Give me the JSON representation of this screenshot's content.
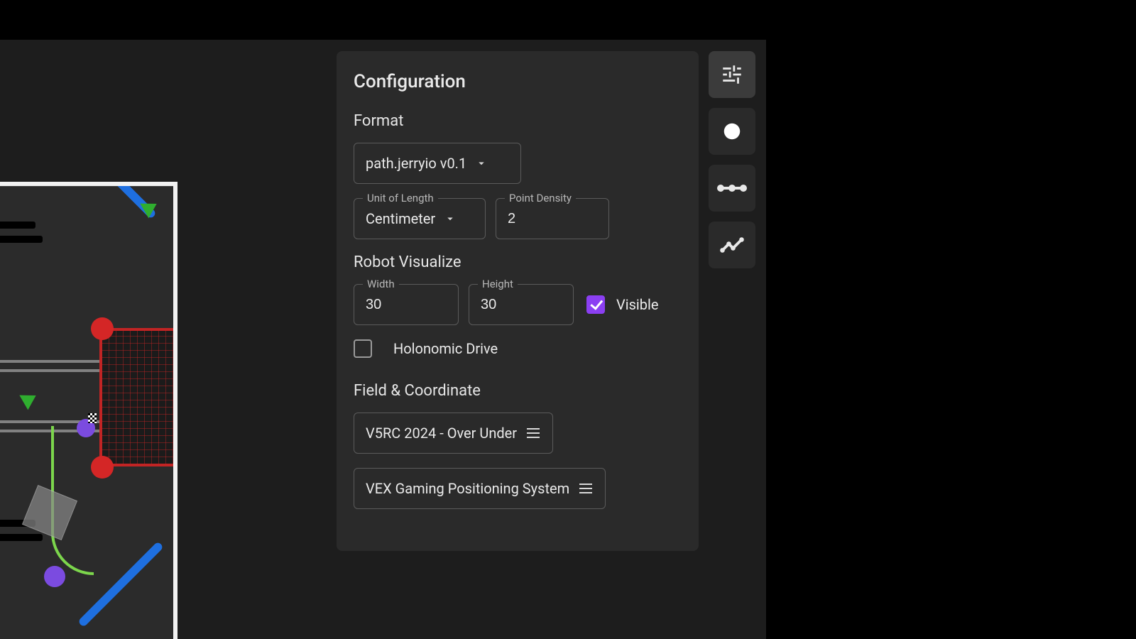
{
  "panel": {
    "title": "Configuration",
    "format": {
      "section_label": "Format",
      "dropdown_value": "path.jerryio v0.1",
      "unit_label": "Unit of Length",
      "unit_value": "Centimeter",
      "density_label": "Point Density",
      "density_value": "2"
    },
    "robot": {
      "section_label": "Robot Visualize",
      "width_label": "Width",
      "width_value": "30",
      "height_label": "Height",
      "height_value": "30",
      "visible_label": "Visible",
      "visible_checked": true,
      "holonomic_label": "Holonomic Drive",
      "holonomic_checked": false
    },
    "field": {
      "section_label": "Field & Coordinate",
      "field_value": "V5RC 2024 - Over Under",
      "coord_value": "VEX Gaming Positioning System"
    }
  },
  "rail": {
    "tune": "tune-icon",
    "circle": "circle-icon",
    "segment": "segment-icon",
    "trend": "trend-icon"
  },
  "colors": {
    "accent": "#8b3ff2",
    "panel_bg": "#2a2a2a",
    "border": "#5b5b5b"
  }
}
